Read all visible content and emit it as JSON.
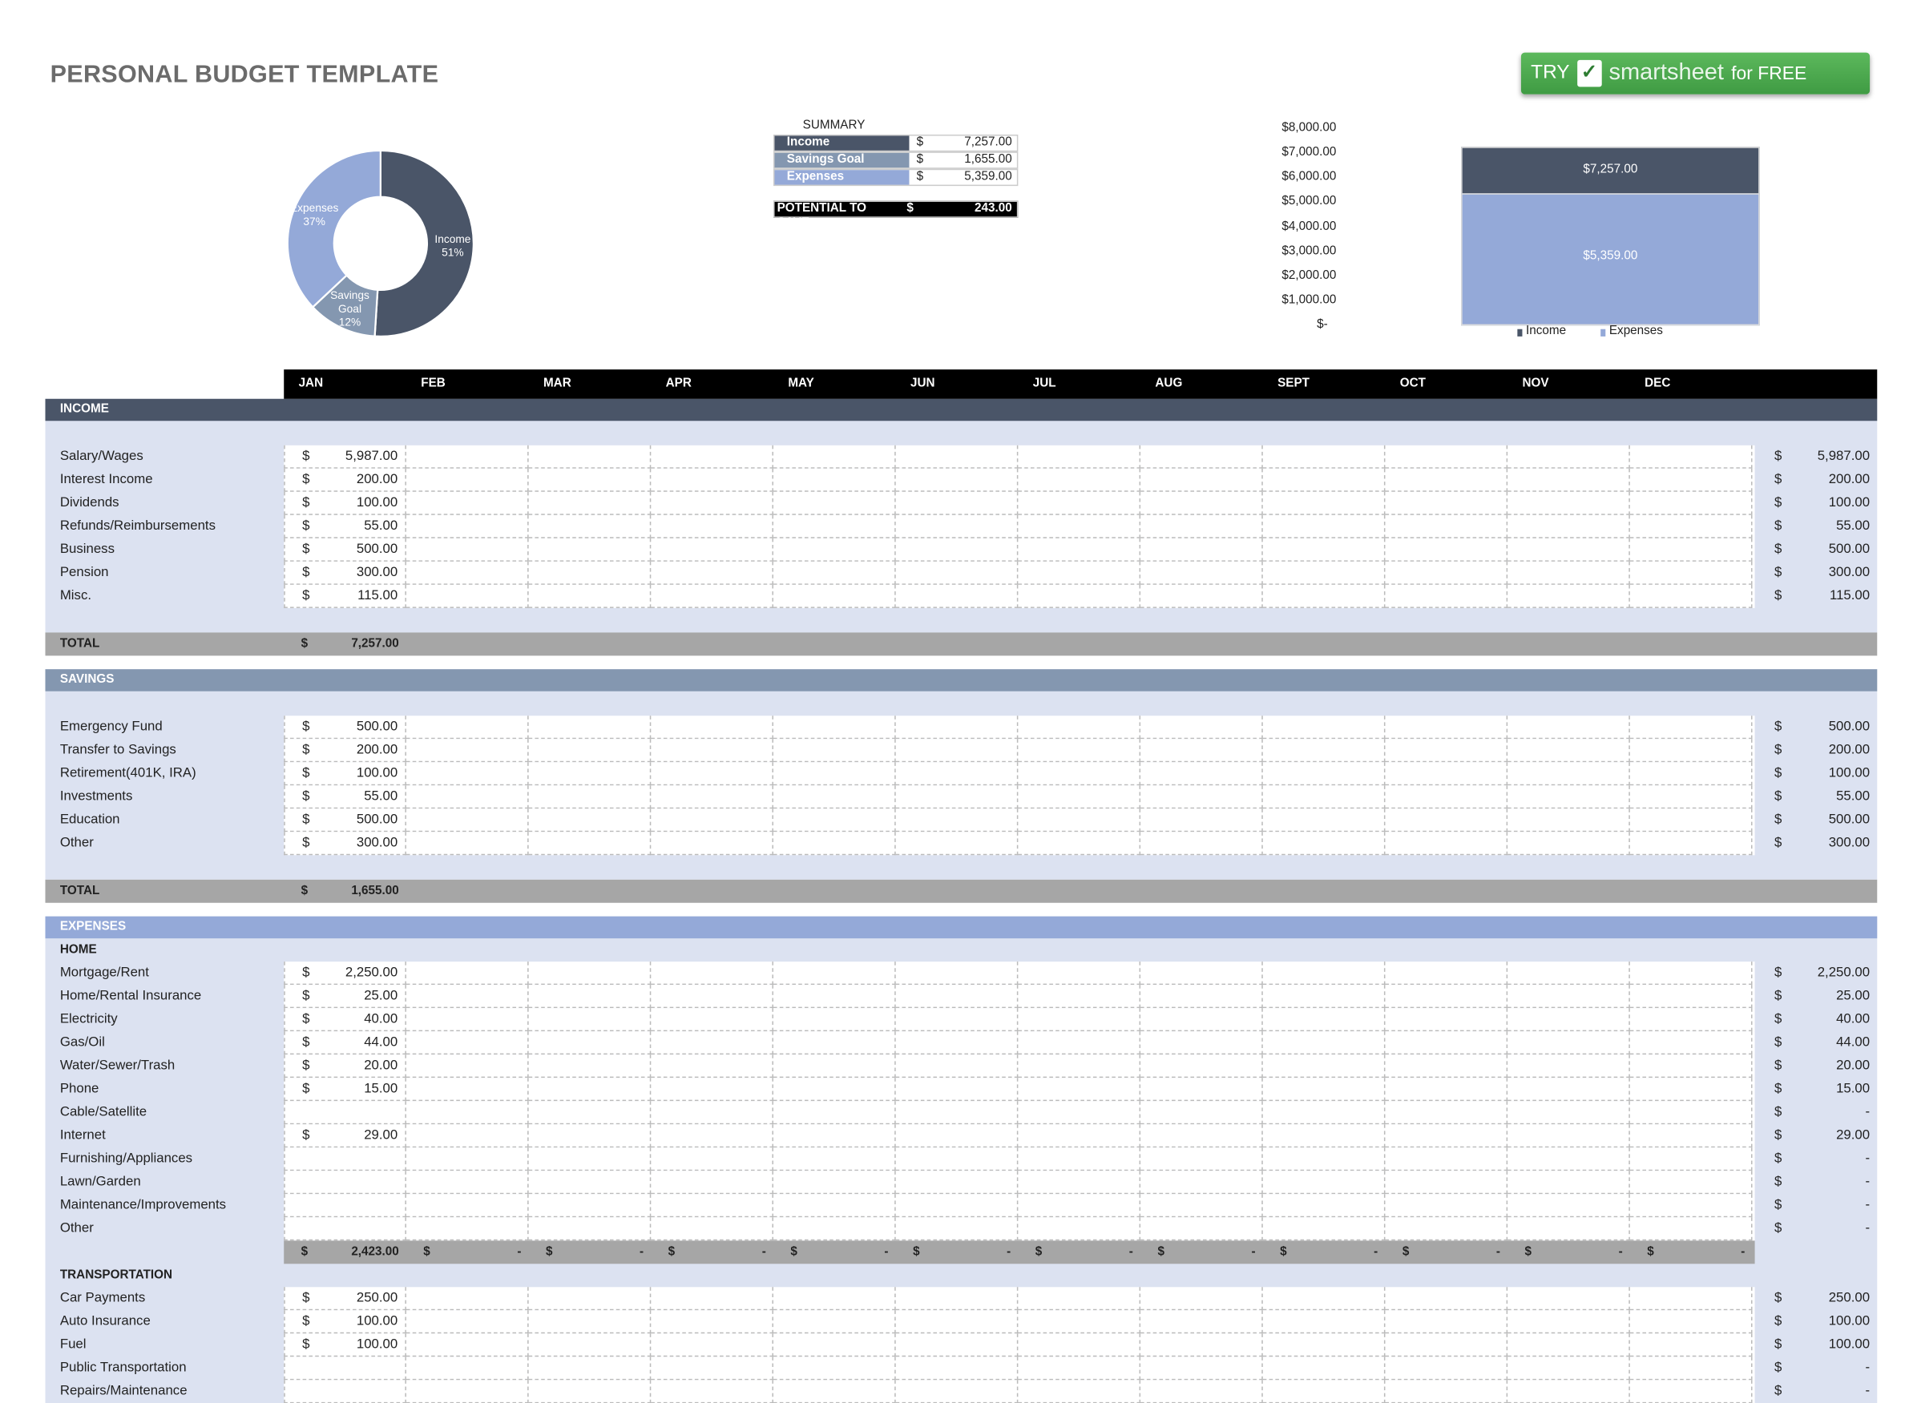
{
  "title": "PERSONAL BUDGET TEMPLATE",
  "cta": {
    "try": "TRY",
    "brand": "smartsheet",
    "free": "for FREE"
  },
  "colors": {
    "income": "#4a5568",
    "savings": "#8497b0",
    "expenses": "#94a9d8",
    "total": "#a6a6a6",
    "section_bg": "#dce2f1"
  },
  "donut": {
    "slices": [
      {
        "label": "Income",
        "pct": 51,
        "text": "51%"
      },
      {
        "label": "Savings Goal",
        "pct": 12,
        "text": "12%"
      },
      {
        "label": "Expenses",
        "pct": 37,
        "text": "37%"
      }
    ]
  },
  "summary": {
    "title": "SUMMARY",
    "rows": [
      {
        "label": "Income",
        "cur": "$",
        "value": "7,257.00"
      },
      {
        "label": "Savings Goal",
        "cur": "$",
        "value": "1,655.00"
      },
      {
        "label": "Expenses",
        "cur": "$",
        "value": "5,359.00"
      }
    ],
    "potential": {
      "label": "POTENTIAL TO SAVE",
      "cur": "$",
      "value": "243.00"
    }
  },
  "chart_data": {
    "type": "bar",
    "categories": [
      ""
    ],
    "series": [
      {
        "name": "Income",
        "values": [
          7257
        ],
        "label": "$7,257.00"
      },
      {
        "name": "Expenses",
        "values": [
          5359
        ],
        "label": "$5,359.00"
      }
    ],
    "ylim": [
      0,
      8000
    ],
    "yticks": [
      "$8,000.00",
      "$7,000.00",
      "$6,000.00",
      "$5,000.00",
      "$4,000.00",
      "$3,000.00",
      "$2,000.00",
      "$1,000.00",
      "$-"
    ],
    "legend": "bottom",
    "overlap": true
  },
  "months": [
    "JAN",
    "FEB",
    "MAR",
    "APR",
    "MAY",
    "JUN",
    "JUL",
    "AUG",
    "SEPT",
    "OCT",
    "NOV",
    "DEC"
  ],
  "income": {
    "header": "INCOME",
    "rows": [
      {
        "label": "Salary/Wages",
        "jan": "5,987.00",
        "total": "5,987.00"
      },
      {
        "label": "Interest Income",
        "jan": "200.00",
        "total": "200.00"
      },
      {
        "label": "Dividends",
        "jan": "100.00",
        "total": "100.00"
      },
      {
        "label": "Refunds/Reimbursements",
        "jan": "55.00",
        "total": "55.00"
      },
      {
        "label": "Business",
        "jan": "500.00",
        "total": "500.00"
      },
      {
        "label": "Pension",
        "jan": "300.00",
        "total": "300.00"
      },
      {
        "label": "Misc.",
        "jan": "115.00",
        "total": "115.00"
      }
    ],
    "total_label": "TOTAL",
    "total_value": "7,257.00"
  },
  "savings": {
    "header": "SAVINGS",
    "rows": [
      {
        "label": "Emergency Fund",
        "jan": "500.00",
        "total": "500.00"
      },
      {
        "label": "Transfer to Savings",
        "jan": "200.00",
        "total": "200.00"
      },
      {
        "label": "Retirement(401K, IRA)",
        "jan": "100.00",
        "total": "100.00"
      },
      {
        "label": "Investments",
        "jan": "55.00",
        "total": "55.00"
      },
      {
        "label": "Education",
        "jan": "500.00",
        "total": "500.00"
      },
      {
        "label": "Other",
        "jan": "300.00",
        "total": "300.00"
      }
    ],
    "total_label": "TOTAL",
    "total_value": "1,655.00"
  },
  "expenses": {
    "header": "EXPENSES",
    "groups": [
      {
        "label": "HOME",
        "rows": [
          {
            "label": "Mortgage/Rent",
            "jan": "2,250.00",
            "total": "2,250.00"
          },
          {
            "label": "Home/Rental Insurance",
            "jan": "25.00",
            "total": "25.00"
          },
          {
            "label": "Electricity",
            "jan": "40.00",
            "total": "40.00"
          },
          {
            "label": "Gas/Oil",
            "jan": "44.00",
            "total": "44.00"
          },
          {
            "label": "Water/Sewer/Trash",
            "jan": "20.00",
            "total": "20.00"
          },
          {
            "label": "Phone",
            "jan": "15.00",
            "total": "15.00"
          },
          {
            "label": "Cable/Satellite",
            "jan": "",
            "total": "-"
          },
          {
            "label": "Internet",
            "jan": "29.00",
            "total": "29.00"
          },
          {
            "label": "Furnishing/Appliances",
            "jan": "",
            "total": "-"
          },
          {
            "label": "Lawn/Garden",
            "jan": "",
            "total": "-"
          },
          {
            "label": "Maintenance/Improvements",
            "jan": "",
            "total": "-"
          },
          {
            "label": "Other",
            "jan": "",
            "total": "-"
          }
        ],
        "subtotals": [
          "2,423.00",
          "-",
          "-",
          "-",
          "-",
          "-",
          "-",
          "-",
          "-",
          "-",
          "-",
          "-"
        ]
      },
      {
        "label": "TRANSPORTATION",
        "rows": [
          {
            "label": "Car Payments",
            "jan": "250.00",
            "total": "250.00"
          },
          {
            "label": "Auto Insurance",
            "jan": "100.00",
            "total": "100.00"
          },
          {
            "label": "Fuel",
            "jan": "100.00",
            "total": "100.00"
          },
          {
            "label": "Public Transportation",
            "jan": "",
            "total": "-"
          },
          {
            "label": "Repairs/Maintenance",
            "jan": "",
            "total": "-"
          }
        ]
      }
    ]
  },
  "currency": "$"
}
